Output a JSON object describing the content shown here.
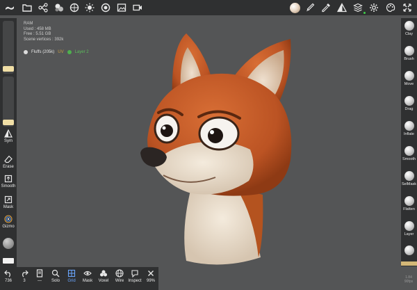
{
  "top_toolbar": {
    "icons": [
      "logo-icon",
      "folder-icon",
      "scene-icon",
      "shading-icon",
      "material-icon",
      "light-icon",
      "camera-icon",
      "image-icon",
      "video-icon",
      "material-ball",
      "brush-icon",
      "picker-icon",
      "symmetry-icon",
      "stack-icon",
      "settings-icon",
      "palette-icon",
      "transform-icon"
    ]
  },
  "stats": {
    "ram_label": "RAM",
    "used": "Used : 458 MB",
    "free": "Free : 5.51 GB",
    "vertices": "Scene vertices : 392k"
  },
  "layers": {
    "mesh": "Fluffs (205k)",
    "uv": "UV",
    "layer": "Layer 2"
  },
  "left_panel": {
    "sym": "Sym",
    "erase": "Erase",
    "smooth": "Smooth",
    "mask": "Mask",
    "gizmo": "Gizmo"
  },
  "right_panel": {
    "tools": [
      "Clay",
      "Brush",
      "Move",
      "Drag",
      "Inflate",
      "Smooth",
      "SelMask",
      "Flatten",
      "Layer"
    ],
    "version_top": "1.84",
    "version_bottom": "90fps"
  },
  "bottom_bar": {
    "undo": "736",
    "redo": "3",
    "page": "—",
    "solo": "Solo",
    "grid": "Grid",
    "mask": "Mask",
    "voxel": "Voxel",
    "wire": "Wire",
    "inspect": "Inspect",
    "zoom": "99%"
  },
  "colors": {
    "background": "#545556",
    "panel": "#2f3031",
    "accent_blue": "#6aa6ff",
    "slider_knob": "#f1dfa6",
    "fox_orange": "#c55a25",
    "fox_cream": "#efe4d4"
  }
}
